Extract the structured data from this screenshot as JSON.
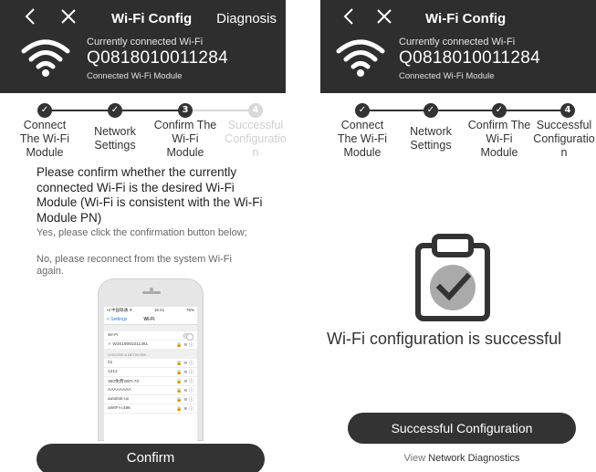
{
  "left": {
    "header": {
      "title": "Wi-Fi Config",
      "diagnosis": "Diagnosis",
      "conn_label": "Currently connected Wi-Fi",
      "conn_id": "Q0818010011284",
      "conn_sub": "Connected Wi-Fi Module"
    },
    "steps": [
      {
        "marker": "✓",
        "label": "Connect\nThe Wi-Fi\nModule",
        "state": "done"
      },
      {
        "marker": "✓",
        "label": "Network\nSettings",
        "state": "done"
      },
      {
        "marker": "3",
        "label": "Confirm The\nWi-Fi\nModule",
        "state": "current"
      },
      {
        "marker": "4",
        "label": "Successful\nConfiguratio\nn",
        "state": "pending"
      }
    ],
    "message": "Please confirm whether the currently connected Wi-Fi is the desired Wi-Fi Module (Wi-Fi is consistent with the Wi-Fi Module PN)",
    "hint_yes": "Yes, please click the confirmation button below;",
    "hint_no": "No, please reconnect from the system Wi-Fi again.",
    "phone": {
      "status_left": "•ıl 中国联通 ✈",
      "status_time": "16:41",
      "status_right": "76%",
      "nav_back": "< Settings",
      "nav_title": "Wi-Fi",
      "wifi_label": "Wi-Fi",
      "connected_network": "✓  W2019081011361",
      "section_label": "CHOOSE A NETWORK...",
      "networks": [
        "01",
        "1212",
        "360免费WiFi-70",
        "AAAAAAAA",
        "autolink-ux",
        "aWIFI-c496"
      ]
    },
    "confirm_button": "Confirm"
  },
  "right": {
    "header": {
      "title": "Wi-Fi Config",
      "conn_label": "Currently connected Wi-Fi",
      "conn_id": "Q0818010011284",
      "conn_sub": "Connected Wi-Fi Module"
    },
    "steps": [
      {
        "marker": "✓",
        "label": "Connect\nThe Wi-Fi\nModule",
        "state": "done"
      },
      {
        "marker": "✓",
        "label": "Network\nSettings",
        "state": "done"
      },
      {
        "marker": "✓",
        "label": "Confirm The\nWi-Fi\nModule",
        "state": "done"
      },
      {
        "marker": "4",
        "label": "Successful\nConfiguratio\nn",
        "state": "current"
      }
    ],
    "success_text": "Wi-Fi configuration is successful",
    "success_button": "Successful Configuration",
    "view_prefix": "View",
    "view_link": "Network Diagnostics"
  },
  "icons": {
    "back": "back-chevron-icon",
    "close": "close-icon",
    "wifi": "wifi-icon",
    "clipboard": "clipboard-check-icon"
  },
  "colors": {
    "header_bg": "#2e2e2e",
    "button_bg": "#333333",
    "step_done": "#333333",
    "step_pending": "#d8d8d8"
  }
}
